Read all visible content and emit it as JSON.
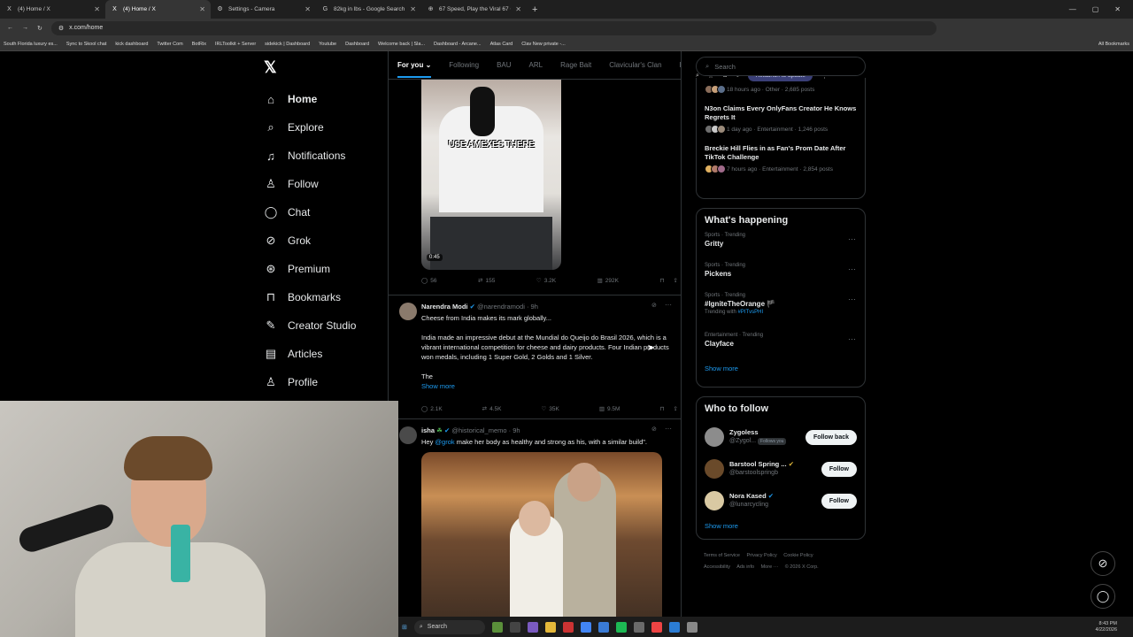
{
  "browser": {
    "tabs": [
      {
        "icon": "X",
        "title": "(4) Home / X",
        "active": false
      },
      {
        "icon": "X",
        "title": "(4) Home / X",
        "active": true
      },
      {
        "icon": "⚙",
        "title": "Settings - Camera",
        "active": false
      },
      {
        "icon": "G",
        "title": "82kg in lbs - Google Search",
        "active": false
      },
      {
        "icon": "⊕",
        "title": "67 Speed, Play the Viral 67 Gam",
        "active": false
      }
    ],
    "url": "x.com/home",
    "relaunch": "Relaunch to update",
    "bookmarks": [
      "South Florida luxury es...",
      "Sync to Skool chat",
      "kick dashboard",
      "Twitter Com",
      "BotRix",
      "IRLToolkit + Server",
      "sidekick | Dashboard",
      "Youtube",
      "Dashboard",
      "Welcome back | Sla...",
      "Dashboard - Arcane...",
      "Atlas Card",
      "Clav New private -..."
    ],
    "all_bookmarks": "All Bookmarks"
  },
  "nav": {
    "items": [
      {
        "icon": "⌂",
        "label": "Home"
      },
      {
        "icon": "⌕",
        "label": "Explore"
      },
      {
        "icon": "♫",
        "label": "Notifications"
      },
      {
        "icon": "♙",
        "label": "Follow"
      },
      {
        "icon": "◯",
        "label": "Chat"
      },
      {
        "icon": "⊘",
        "label": "Grok"
      },
      {
        "icon": "⊛",
        "label": "Premium"
      },
      {
        "icon": "⊓",
        "label": "Bookmarks"
      },
      {
        "icon": "✎",
        "label": "Creator Studio"
      },
      {
        "icon": "▤",
        "label": "Articles"
      },
      {
        "icon": "♙",
        "label": "Profile"
      }
    ]
  },
  "feed": {
    "tabs": [
      "For you",
      "Following",
      "BAU",
      "ARL",
      "Rage Bait",
      "Clavicular's Clan",
      "E"
    ],
    "video": {
      "caption": "USE AMEXES THERE",
      "duration": "0:45",
      "replies": "56",
      "reposts": "155",
      "likes": "3.2K",
      "views": "292K"
    },
    "tweet2": {
      "name": "Narendra Modi",
      "handle": "@narendramodi · 9h",
      "line1": "Cheese from India makes its mark globally...",
      "line2": "India made an impressive debut at the Mundial do Queijo do Brasil 2026, which is a vibrant international competition for cheese and dairy products. Four Indian products won medals, including 1 Super Gold, 2 Golds and 1 Silver.",
      "line3": "The",
      "show_more": "Show more",
      "replies": "2.1K",
      "reposts": "4.5K",
      "likes": "35K",
      "views": "9.5M"
    },
    "tweet3": {
      "name": "isha",
      "handle": "@historical_memo · 9h",
      "text_pre": "Hey ",
      "mention": "@grok",
      "text_post": " make her body as healthy and strong as his, with a similar build\"."
    }
  },
  "sidebar": {
    "search_placeholder": "Search",
    "news": [
      {
        "title": "",
        "meta": "18 hours ago · Other · 2,685 posts"
      },
      {
        "title": "N3on Claims Every OnlyFans Creator He Knows Regrets It",
        "meta": "1 day ago · Entertainment · 1,246 posts"
      },
      {
        "title": "Breckie Hill Flies in as Fan's Prom Date After TikTok Challenge",
        "meta": "7 hours ago · Entertainment · 2,854 posts"
      }
    ],
    "happening_title": "What's happening",
    "trends": [
      {
        "context": "Sports · Trending",
        "name": "Gritty",
        "sub": ""
      },
      {
        "context": "Sports · Trending",
        "name": "Pickens",
        "sub": ""
      },
      {
        "context": "Sports · Trending",
        "name": "#IgniteTheOrange",
        "sub_pre": "Trending with ",
        "sub_tag": "#PITvsPHI"
      },
      {
        "context": "Entertainment · Trending",
        "name": "Clayface",
        "sub": ""
      }
    ],
    "show_more": "Show more",
    "wtf_title": "Who to follow",
    "wtf": [
      {
        "name": "Zygoless",
        "handle": "@Zygol...",
        "badge": "Follows you",
        "btn": "Follow back",
        "color": "#8c8c8c"
      },
      {
        "name": "Barstool Spring ...",
        "handle": "@barstoolspringb",
        "badge": "",
        "btn": "Follow",
        "color": "#6a4a2a"
      },
      {
        "name": "Nora Kased",
        "handle": "@lunarcycling",
        "badge": "",
        "btn": "Follow",
        "color": "#d9c9a3"
      }
    ],
    "footer": [
      "Terms of Service",
      "Privacy Policy",
      "Cookie Policy",
      "Accessibility",
      "Ads info",
      "More ···",
      "© 2026 X Corp."
    ]
  },
  "taskbar": {
    "search": "Search",
    "time": "8:43 PM",
    "date": "4/22/2026"
  },
  "colors": {
    "accent": "#1d9bf0",
    "bg": "#000000",
    "border": "#2f3336"
  }
}
